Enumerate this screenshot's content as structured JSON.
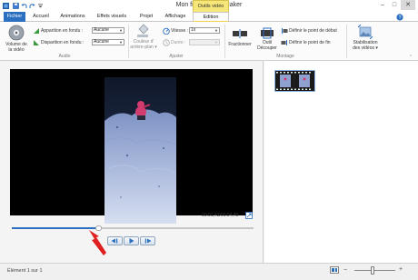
{
  "window": {
    "title": "Mon film - Movie Maker",
    "context_tab_group": "Outils vidéo"
  },
  "tabs": [
    "Fichier",
    "Accueil",
    "Animations",
    "Effets visuels",
    "Projet",
    "Affichage",
    "Edition"
  ],
  "ribbon": {
    "audio": {
      "volume_label_line1": "Volume de",
      "volume_label_line2": "la vidéo",
      "fade_in_label": "Apparition en fondu :",
      "fade_in_value": "Aucune",
      "fade_out_label": "Disparition en fondu :",
      "fade_out_value": "Aucune",
      "group_label": "Audio"
    },
    "adjust": {
      "bg_color_line1": "Couleur d'",
      "bg_color_line2": "arrière-plan ▾",
      "speed_label": "Vitesse :",
      "speed_value": "1x",
      "duration_label": "Durée :",
      "duration_value": "",
      "group_label": "Ajuster"
    },
    "editing": {
      "split_label": "Fractionner",
      "trim_line1": "Outil",
      "trim_line2": "Découper",
      "set_start_label": "Définir le point de début",
      "set_end_label": "Définir le point de fin",
      "group_label": "Montage"
    },
    "stabilization": {
      "line1": "Stabilisation",
      "line2": "des vidéos ▾"
    }
  },
  "player": {
    "timecode": "00:01,43/00:04,49",
    "progress_fraction": 0.36
  },
  "status": {
    "item_count": "Élément 1 sur 1",
    "zoom_fraction": 0.45
  },
  "colors": {
    "file_tab": "#2a6fc0",
    "context_tab": "#f7e67a",
    "arrow": "#e02020"
  }
}
